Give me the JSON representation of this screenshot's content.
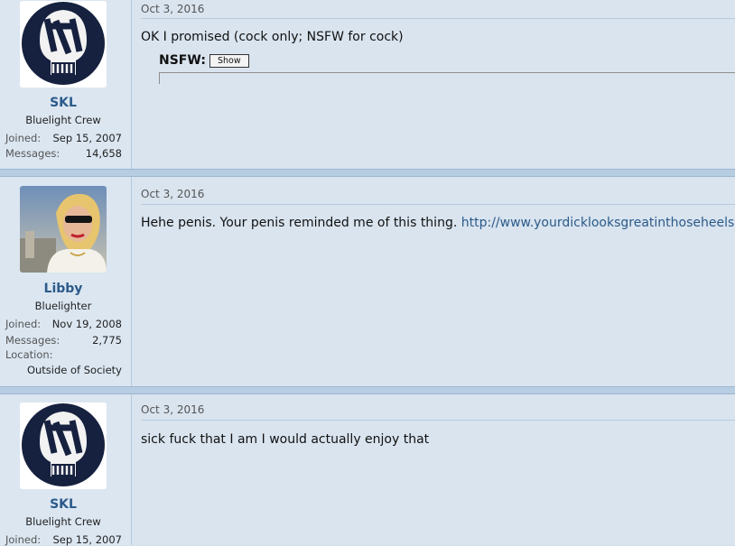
{
  "posts": [
    {
      "author": "SKL",
      "user_title": "Bluelight Crew",
      "joined_label": "Joined:",
      "joined": "Sep 15, 2007",
      "messages_label": "Messages:",
      "messages": "14,658",
      "date": "Oct 3, 2016",
      "text": "OK I promised (cock only; NSFW for cock)",
      "spoiler_label": "NSFW",
      "spoiler_button": "Show"
    },
    {
      "author": "Libby",
      "user_title": "Bluelighter",
      "joined_label": "Joined:",
      "joined": "Nov 19, 2008",
      "messages_label": "Messages:",
      "messages": "2,775",
      "location_label": "Location:",
      "location": "Outside of Society",
      "date": "Oct 3, 2016",
      "text": "Hehe penis. Your penis reminded me of this thing. ",
      "link": "http://www.yourdicklooksgreatinthoseheels.com/"
    },
    {
      "author": "SKL",
      "user_title": "Bluelight Crew",
      "joined_label": "Joined:",
      "joined": "Sep 15, 2007",
      "date": "Oct 3, 2016",
      "text": "sick fuck that I am I would actually enjoy that"
    }
  ],
  "colors": {
    "accent": "#2b5a8a",
    "page_bg": "#d4e0ec",
    "separator": "#b7cde2"
  },
  "icons": {
    "avatar_1": "yankees-skull-avatar",
    "avatar_2": "woman-sunglasses-avatar",
    "avatar_3": "yankees-skull-avatar"
  }
}
